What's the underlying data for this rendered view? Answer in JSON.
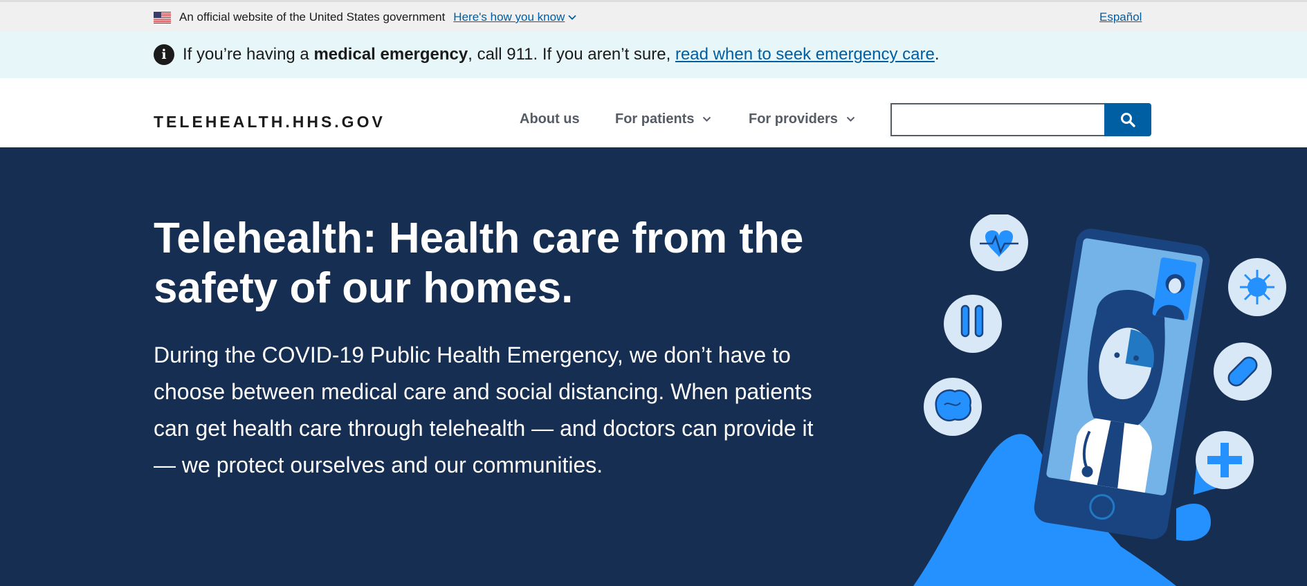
{
  "gov_banner": {
    "text": "An official website of the United States government",
    "link": "Here's how you know",
    "language": "Español"
  },
  "alert": {
    "prefix": "If you’re having a ",
    "bold": "medical emergency",
    "middle": ", call 911. If you aren’t sure, ",
    "link": "read when to seek emergency care",
    "suffix": "."
  },
  "header": {
    "logo": "TELEHEALTH.HHS.GOV",
    "nav": {
      "about": "About us",
      "patients": "For patients",
      "providers": "For providers"
    },
    "search": {
      "value": "",
      "placeholder": ""
    }
  },
  "hero": {
    "title": "Telehealth: Health care from the safety of our homes.",
    "body": "During the COVID-19 Public Health Emergency, we don’t have to choose between medical care and social distancing. When patients can get health care through telehealth — and doctors can provide it — we protect ourselves and our communities."
  },
  "icons": [
    "us-flag-icon",
    "chevron-down-icon",
    "info-icon",
    "search-icon",
    "heart-monitor-icon",
    "test-tubes-icon",
    "brain-icon",
    "virus-icon",
    "pill-icon",
    "plus-icon",
    "phone-illustration"
  ],
  "colors": {
    "brand_blue": "#005ea2",
    "hero_bg": "#162e51",
    "alert_bg": "#e7f6f8",
    "gov_bg": "#f0f0f0",
    "illus_blue": "#2491ff",
    "illus_light": "#d9e8f6"
  }
}
